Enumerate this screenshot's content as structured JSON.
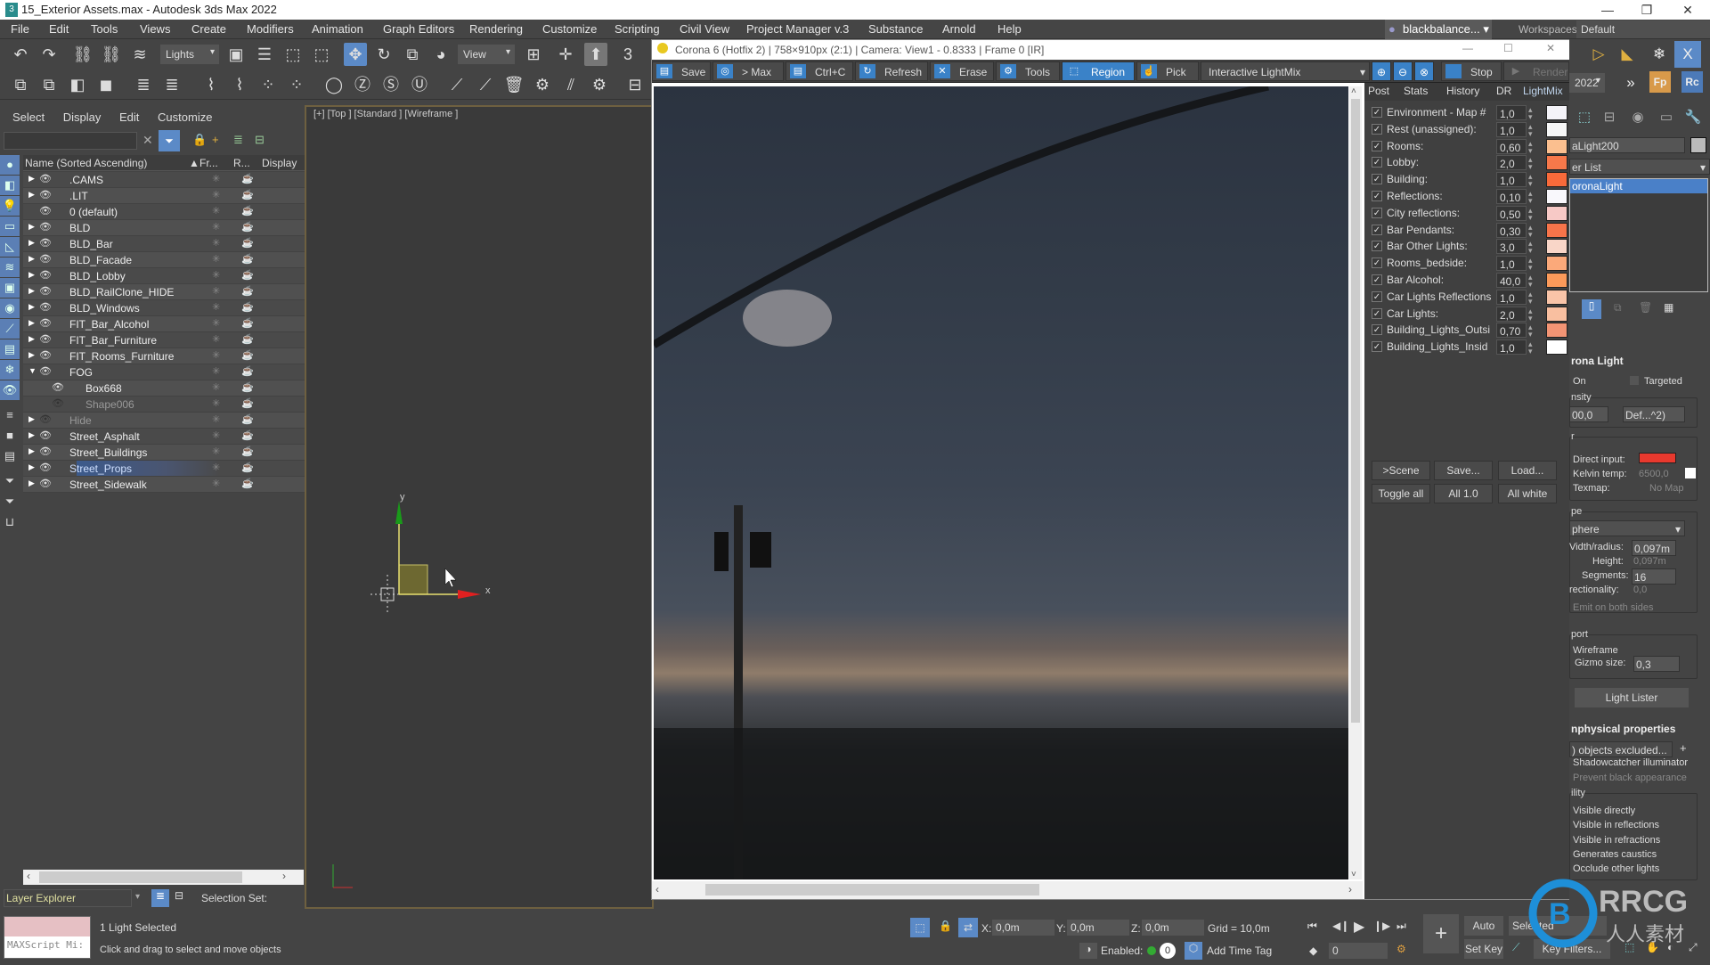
{
  "window": {
    "title": "15_Exterior Assets.max - Autodesk 3ds Max 2022",
    "app_icon": "3",
    "controls": [
      "minimize-icon",
      "restore-icon",
      "close-icon"
    ]
  },
  "menubar": {
    "items": [
      "File",
      "Edit",
      "Tools",
      "Views",
      "Create",
      "Modifiers",
      "Animation",
      "Graph Editors",
      "Rendering",
      "Customize",
      "Scripting",
      "Civil View",
      "Project Manager v.3",
      "Substance",
      "Arnold",
      "Help"
    ],
    "user": "blackbalance...",
    "workspaces_label": "Workspaces:",
    "workspace": "Default"
  },
  "toolbar": {
    "selection_filter": "Lights",
    "reference_coord": "View",
    "project_dropdown": "2022",
    "more": "»",
    "plugin_buttons": [
      "Fp",
      "Rc"
    ]
  },
  "scene_explorer": {
    "menu": [
      "Select",
      "Display",
      "Edit",
      "Customize"
    ],
    "search_value": "",
    "columns": [
      "Name (Sorted Ascending)",
      "Fr...",
      "R...",
      "Display as"
    ],
    "sort_indicator": "▲",
    "rows": [
      {
        "name": ".CAMS",
        "expand": "▶",
        "visible": true
      },
      {
        "name": ".LIT",
        "expand": "▶",
        "visible": true
      },
      {
        "name": "0 (default)",
        "expand": "",
        "visible": true
      },
      {
        "name": "BLD",
        "expand": "▶",
        "visible": true
      },
      {
        "name": "BLD_Bar",
        "expand": "▶",
        "visible": true
      },
      {
        "name": "BLD_Facade",
        "expand": "▶",
        "visible": true
      },
      {
        "name": "BLD_Lobby",
        "expand": "▶",
        "visible": true
      },
      {
        "name": "BLD_RailClone_HIDE",
        "expand": "▶",
        "visible": true
      },
      {
        "name": "BLD_Windows",
        "expand": "▶",
        "visible": true
      },
      {
        "name": "FIT_Bar_Alcohol",
        "expand": "▶",
        "visible": true
      },
      {
        "name": "FIT_Bar_Furniture",
        "expand": "▶",
        "visible": true
      },
      {
        "name": "FIT_Rooms_Furniture",
        "expand": "▶",
        "visible": true
      },
      {
        "name": "FOG",
        "expand": "▼",
        "visible": true
      },
      {
        "name": "Box668",
        "expand": "",
        "visible": true,
        "child": true
      },
      {
        "name": "Shape006",
        "expand": "",
        "visible": false,
        "child": true
      },
      {
        "name": "Hide",
        "expand": "▶",
        "visible": false
      },
      {
        "name": "Street_Asphalt",
        "expand": "▶",
        "visible": true
      },
      {
        "name": "Street_Buildings",
        "expand": "▶",
        "visible": true
      },
      {
        "name": "Street_Props",
        "expand": "▶",
        "visible": true,
        "active": true
      },
      {
        "name": "Street_Sidewalk",
        "expand": "▶",
        "visible": true
      }
    ],
    "explorer_type": "Layer Explorer",
    "selection_set_label": "Selection Set:"
  },
  "viewport": {
    "label": "[+] [Top ] [Standard ] [Wireframe ]",
    "axis_x": "x",
    "axis_y": "y"
  },
  "render_window": {
    "title": "Corona 6 (Hotfix 2) | 758×910px (2:1) | Camera: View1 - 0.8333 | Frame 0 [IR]",
    "toolbar": [
      "Save",
      "> Max",
      "Ctrl+C",
      "Refresh",
      "Erase",
      "Tools",
      "Region",
      "Pick"
    ],
    "mode": "Interactive LightMix",
    "stop_label": "Stop",
    "render_label": "Render",
    "tabs": [
      "Post",
      "Stats",
      "History",
      "DR",
      "LightMix"
    ],
    "active_tab": "LightMix",
    "lightmix": [
      {
        "label": "Environment - Map #",
        "value": "1,0",
        "color": "#f4f3f8"
      },
      {
        "label": "Rest (unassigned):",
        "value": "1,0",
        "color": "#f6f6f6"
      },
      {
        "label": "Rooms:",
        "value": "0,60",
        "color": "#fbbf8f"
      },
      {
        "label": "Lobby:",
        "value": "2,0",
        "color": "#f7784a"
      },
      {
        "label": "Building:",
        "value": "1,0",
        "color": "#f86a3a"
      },
      {
        "label": "Reflections:",
        "value": "0,10",
        "color": "#f9f8fc"
      },
      {
        "label": "City reflections:",
        "value": "0,50",
        "color": "#f7c9c6"
      },
      {
        "label": "Bar Pendants:",
        "value": "0,30",
        "color": "#f7744a"
      },
      {
        "label": "Bar Other Lights:",
        "value": "3,0",
        "color": "#f9d6c8"
      },
      {
        "label": "Rooms_bedside:",
        "value": "1,0",
        "color": "#fba97a"
      },
      {
        "label": "Bar Alcohol:",
        "value": "40,0",
        "color": "#fb9a5a"
      },
      {
        "label": "Car Lights Reflections",
        "value": "1,0",
        "color": "#f9c4a8"
      },
      {
        "label": "Car Lights:",
        "value": "2,0",
        "color": "#f9bfa0"
      },
      {
        "label": "Building_Lights_Outsi",
        "value": "0,70",
        "color": "#f39474"
      },
      {
        "label": "Building_Lights_Insid",
        "value": "1,0",
        "color": "#ffffff"
      }
    ],
    "buttons_row1": [
      ">Scene",
      "Save...",
      "Load..."
    ],
    "buttons_row2": [
      "Toggle all",
      "All 1.0",
      "All white"
    ]
  },
  "command_panel": {
    "object_name": "aLight200",
    "modifier_list": "er List",
    "stack_item": "oronaLight",
    "rollout_title": "rona Light",
    "on_label": "On",
    "targeted_label": "Targeted",
    "intensity_group": "nsity",
    "intensity_value": "00,0",
    "intensity_unit": "Def...^2)",
    "color_group": "r",
    "direct_input_label": "Direct input:",
    "direct_input_color": "#e8392e",
    "kelvin_label": "Kelvin temp:",
    "kelvin_value": "6500,0",
    "texmap_label": "Texmap:",
    "texmap_value": "No Map",
    "shape_group": "pe",
    "shape_value": "phere",
    "width_label": "Vidth/radius:",
    "width_value": "0,097m",
    "height_label": "Height:",
    "height_value": "0,097m",
    "segments_label": "Segments:",
    "segments_value": "16",
    "directionality_label": "rectionality:",
    "directionality_value": "0,0",
    "emit_both": "Emit on both sides",
    "viewport_group": "port",
    "wireframe_label": "Wireframe",
    "gizmo_label": "Gizmo size:",
    "gizmo_value": "0,3",
    "light_lister": "Light Lister",
    "nonphys_title": "nphysical properties",
    "excluded": ") objects excluded...",
    "excluded_add": "+",
    "shadowcatcher": "Shadowcatcher illuminator",
    "prevent_black": "Prevent black appearance",
    "visibility_group": "ility",
    "visibility": [
      "Visible directly",
      "Visible in reflections",
      "Visible in refractions",
      "Generates caustics",
      "Occlude other lights"
    ]
  },
  "status_bar": {
    "maxscript": "MAXScript Mi:",
    "selection_info": "1 Light Selected",
    "prompt": "Click and drag to select and move objects",
    "x_label": "X:",
    "x_value": "0,0m",
    "y_label": "Y:",
    "y_value": "0,0m",
    "z_label": "Z:",
    "z_value": "0,0m",
    "grid": "Grid = 10,0m",
    "enabled_label": "Enabled:",
    "enabled_value": "0",
    "time_tag": "Add Time Tag",
    "frame": "0",
    "auto_key": "Auto Key",
    "set_key": "Set Key",
    "selected": "Selected",
    "key_filters": "Key Filters..."
  },
  "watermark": {
    "brand": "RRCG",
    "sub": "人人素材"
  }
}
